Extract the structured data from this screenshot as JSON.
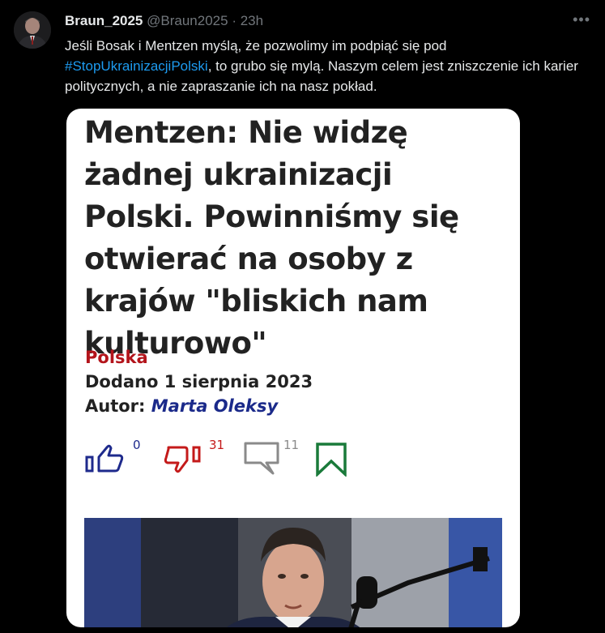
{
  "tweet": {
    "author_name": "Braun_2025",
    "handle": "@Braun2025",
    "separator": "·",
    "time": "23h",
    "more_label": "•••",
    "text_before": "Jeśli Bosak i Mentzen myślą, że pozwolimy im podpiąć się pod ",
    "hashtag": "#StopUkrainizacjiPolski",
    "text_after": ", to grubo się mylą. Naszym celem jest zniszczenie ich karier politycznych, a nie zapraszanie ich na nasz pokład."
  },
  "article": {
    "headline": "Mentzen: Nie widzę żadnej ukrainizacji Polski. Powinniśmy się otwierać na osoby z krajów \"bliskich nam kulturowo\"",
    "category": "Polska",
    "date_text": "Dodano 1 sierpnia 2023",
    "author_label": "Autor:",
    "author_name": "Marta Oleksy",
    "likes": "0",
    "dislikes": "31",
    "comments": "11"
  },
  "colors": {
    "accent_hashtag": "#1d9bf0",
    "category_red": "#b3141b",
    "author_blue": "#1b2a8a",
    "like_blue": "#1e2a8c",
    "dislike_red": "#c41a1a",
    "bookmark_green": "#1a7a3a"
  },
  "icons": {
    "like": "thumbs-up-icon",
    "dislike": "thumbs-down-icon",
    "comment": "comment-icon",
    "bookmark": "bookmark-icon"
  }
}
